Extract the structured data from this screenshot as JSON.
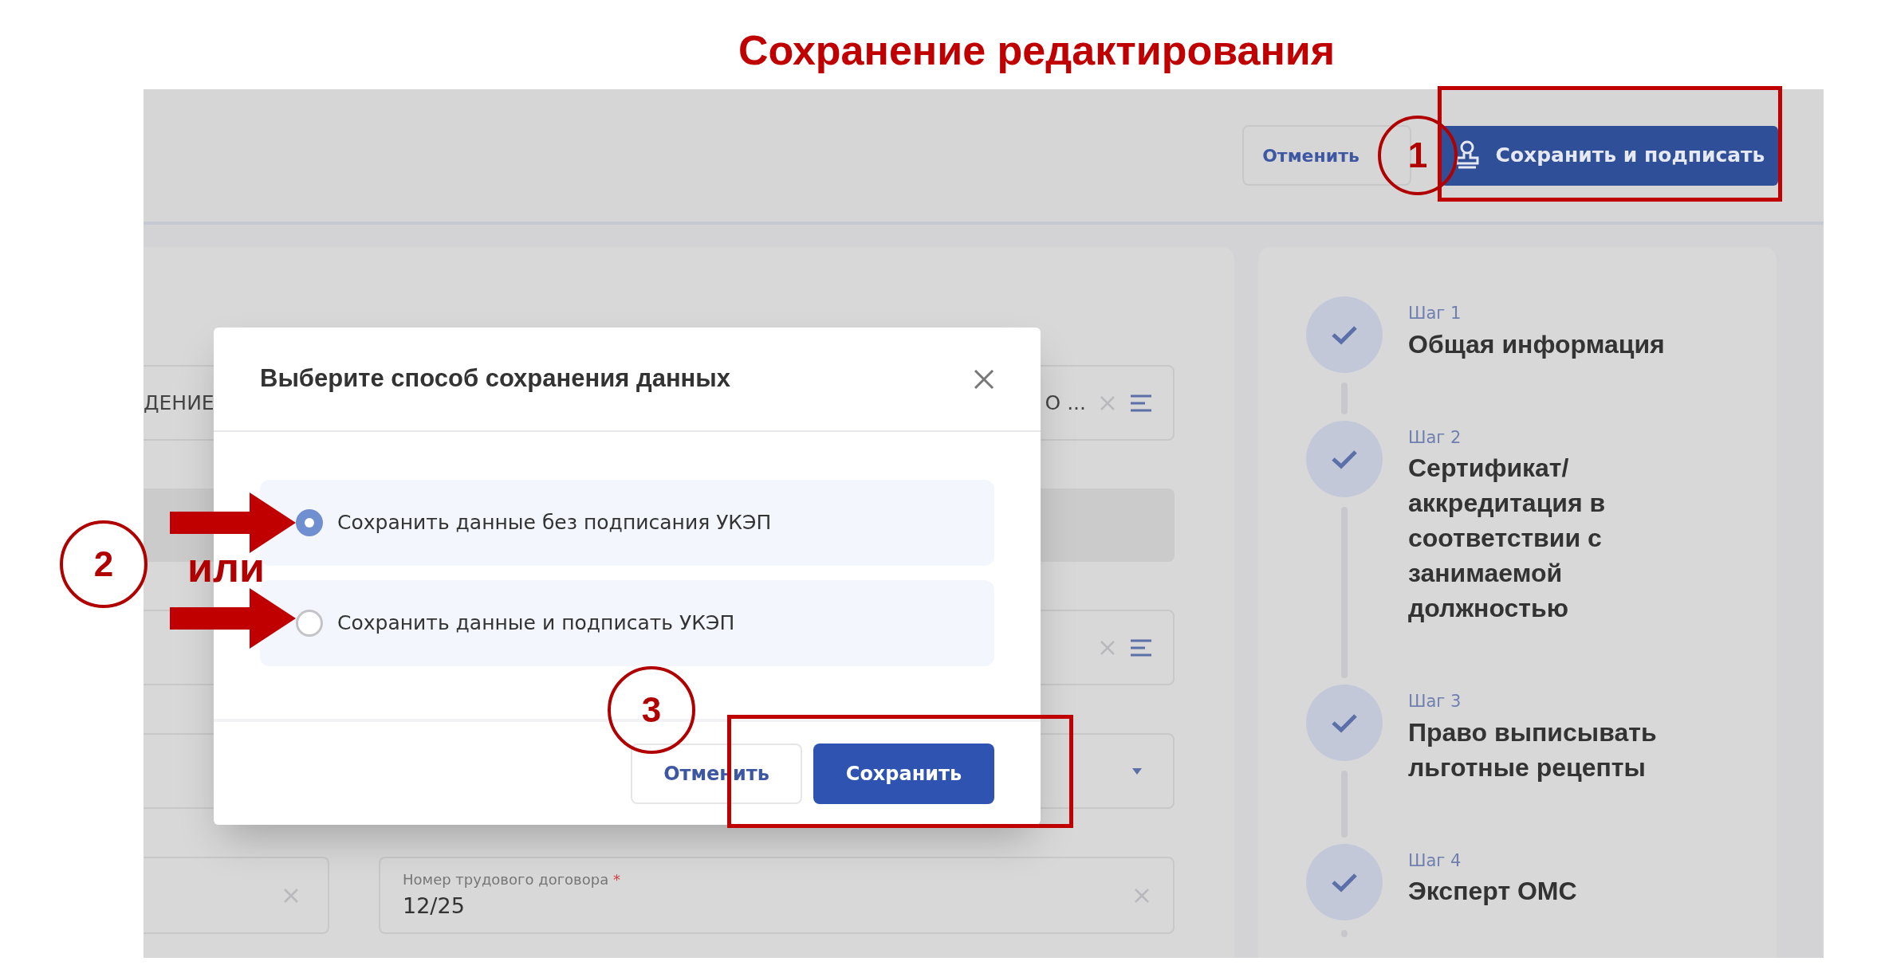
{
  "annotation_title": "Сохранение редактирования",
  "header": {
    "cancel_button": "Отменить",
    "sign_button": "Сохранить и подписать"
  },
  "form_fields": [
    {
      "kind": "multiselect",
      "texts": [
        "ДЕНИЕ",
        "О ..."
      ]
    },
    {
      "kind": "disabled"
    },
    {
      "kind": "multiselect"
    },
    {
      "kind": "dropdown"
    },
    {
      "kind": "pair",
      "right": {
        "label": "Номер трудового договора",
        "required_mark": "*",
        "value": "12/25"
      }
    }
  ],
  "dialog": {
    "title": "Выберите способ сохранения данных",
    "options": [
      {
        "label": "Сохранить данные без подписания УКЭП",
        "selected": true
      },
      {
        "label": "Сохранить данные и подписать УКЭП",
        "selected": false
      }
    ],
    "cancel_button": "Отменить",
    "save_button": "Сохранить"
  },
  "steps": [
    {
      "step": "Шаг 1",
      "title": "Общая информация",
      "completed": true
    },
    {
      "step": "Шаг 2",
      "title": "Сертификат/ аккредитация в соответствии с занимаемой должностью",
      "completed": true
    },
    {
      "step": "Шаг 3",
      "title": "Право выписывать льготные рецепты",
      "completed": true
    },
    {
      "step": "Шаг 4",
      "title": "Эксперт ОМС",
      "completed": true
    }
  ],
  "annotations": {
    "markers": [
      "1",
      "2",
      "3"
    ],
    "or_label": "или"
  }
}
